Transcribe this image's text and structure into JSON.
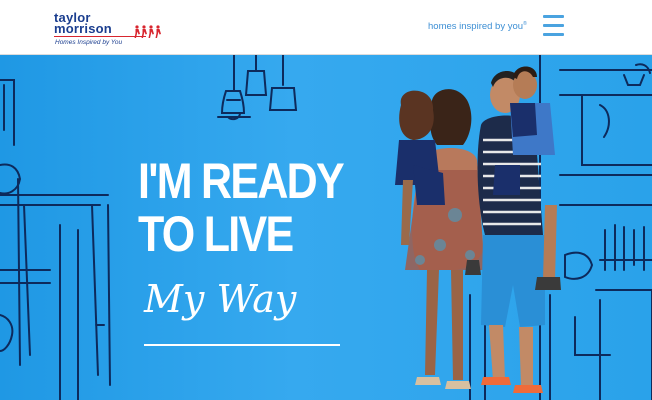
{
  "brand": {
    "name_line1": "taylor",
    "name_line2": "morrison",
    "tagline": "Homes Inspired by You",
    "color": "#1b3e8f",
    "accent": "#d8262f"
  },
  "header": {
    "tagline": "homes inspired by you",
    "tagline_mark": "®",
    "menu_icon": "hamburger-menu-icon"
  },
  "hero": {
    "headline_line1": "I'M READY",
    "headline_line2": "TO LIVE",
    "script_text": "My Way",
    "background": "#2aa2ea"
  }
}
